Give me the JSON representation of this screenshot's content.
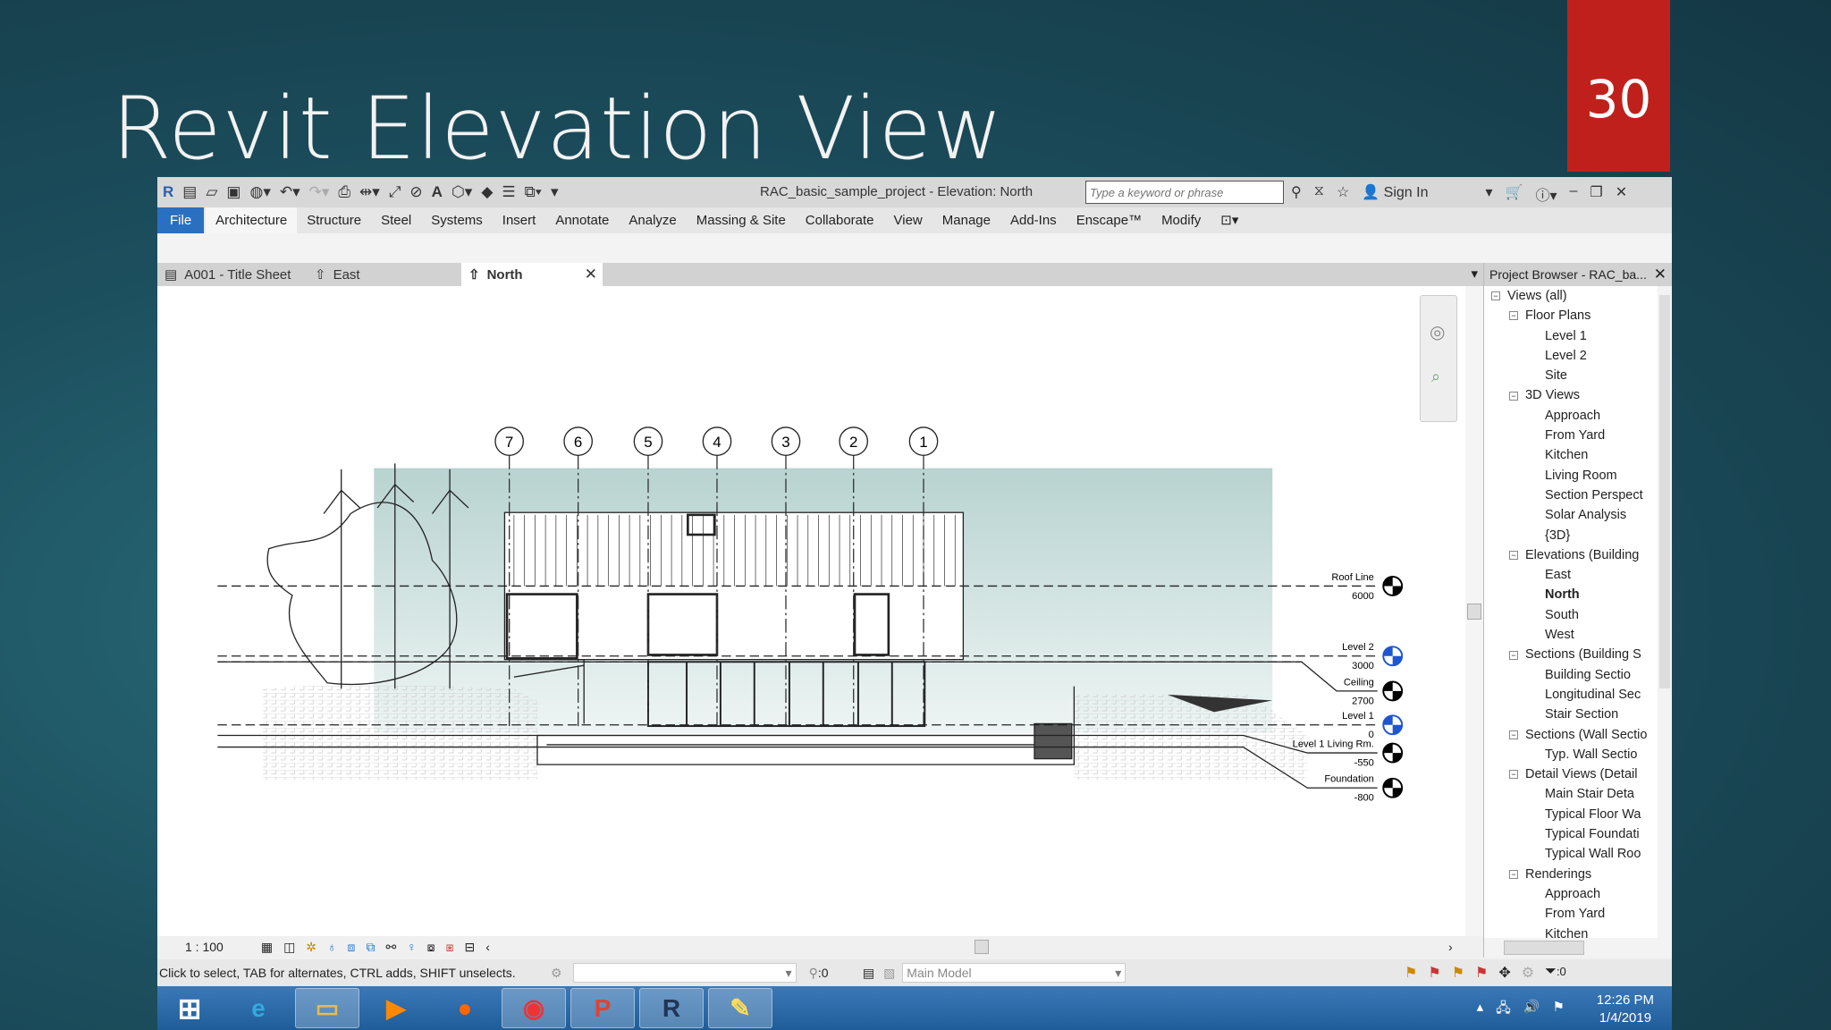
{
  "slide": {
    "title": "Revit Elevation View",
    "page_number": "30"
  },
  "app": {
    "window_title": "RAC_basic_sample_project - Elevation: North",
    "search_placeholder": "Type a keyword or phrase",
    "sign_in": "Sign In"
  },
  "ribbon_tabs": [
    "File",
    "Architecture",
    "Structure",
    "Steel",
    "Systems",
    "Insert",
    "Annotate",
    "Analyze",
    "Massing & Site",
    "Collaborate",
    "View",
    "Manage",
    "Add-Ins",
    "Enscape™",
    "Modify"
  ],
  "view_tabs": [
    {
      "label": "A001 - Title Sheet"
    },
    {
      "label": "East"
    },
    {
      "label": "North",
      "active": true
    }
  ],
  "grid_labels": [
    "7",
    "6",
    "5",
    "4",
    "3",
    "2",
    "1"
  ],
  "levels": [
    {
      "name": "Roof Line",
      "elevation": "6000",
      "color": "black"
    },
    {
      "name": "Level 2",
      "elevation": "3000",
      "color": "blue"
    },
    {
      "name": "Ceiling",
      "elevation": "2700",
      "color": "black"
    },
    {
      "name": "Level 1",
      "elevation": "0",
      "color": "blue"
    },
    {
      "name": "Level 1 Living Rm.",
      "elevation": "-550",
      "color": "black"
    },
    {
      "name": "Foundation",
      "elevation": "-800",
      "color": "black"
    }
  ],
  "view_bar": {
    "scale": "1 : 100"
  },
  "status_bar": {
    "message": "Click to select, TAB for alternates, CTRL adds, SHIFT unselects.",
    "workset_count": ":0",
    "model": "Main Model",
    "filter_count": ":0"
  },
  "project_browser": {
    "title": "Project Browser - RAC_ba...",
    "items": [
      {
        "label": "Views (all)",
        "level": 0,
        "toggle": "−"
      },
      {
        "label": "Floor Plans",
        "level": 1,
        "toggle": "−"
      },
      {
        "label": "Level 1",
        "level": 2
      },
      {
        "label": "Level 2",
        "level": 2
      },
      {
        "label": "Site",
        "level": 2
      },
      {
        "label": "3D Views",
        "level": 1,
        "toggle": "−"
      },
      {
        "label": "Approach",
        "level": 2
      },
      {
        "label": "From Yard",
        "level": 2
      },
      {
        "label": "Kitchen",
        "level": 2
      },
      {
        "label": "Living Room",
        "level": 2
      },
      {
        "label": "Section Perspect",
        "level": 2
      },
      {
        "label": "Solar Analysis",
        "level": 2
      },
      {
        "label": "{3D}",
        "level": 2
      },
      {
        "label": "Elevations (Building",
        "level": 1,
        "toggle": "−"
      },
      {
        "label": "East",
        "level": 2
      },
      {
        "label": "North",
        "level": 2,
        "selected": true
      },
      {
        "label": "South",
        "level": 2
      },
      {
        "label": "West",
        "level": 2
      },
      {
        "label": "Sections (Building S",
        "level": 1,
        "toggle": "−"
      },
      {
        "label": "Building Sectio",
        "level": 2
      },
      {
        "label": "Longitudinal Sec",
        "level": 2
      },
      {
        "label": "Stair Section",
        "level": 2
      },
      {
        "label": "Sections (Wall Sectio",
        "level": 1,
        "toggle": "−"
      },
      {
        "label": "Typ. Wall Sectio",
        "level": 2
      },
      {
        "label": "Detail Views (Detail",
        "level": 1,
        "toggle": "−"
      },
      {
        "label": "Main Stair Deta",
        "level": 2
      },
      {
        "label": "Typical Floor Wa",
        "level": 2
      },
      {
        "label": "Typical Foundati",
        "level": 2
      },
      {
        "label": "Typical Wall Roo",
        "level": 2
      },
      {
        "label": "Renderings",
        "level": 1,
        "toggle": "−"
      },
      {
        "label": "Approach",
        "level": 2
      },
      {
        "label": "From Yard",
        "level": 2
      },
      {
        "label": "Kitchen",
        "level": 2
      }
    ]
  },
  "taskbar": {
    "time": "12:26 PM",
    "date": "1/4/2019",
    "apps": [
      "start",
      "internet-explorer",
      "file-explorer",
      "media-player",
      "firefox",
      "chrome",
      "powerpoint",
      "revit",
      "paint"
    ]
  },
  "colors": {
    "file_tab": "#2a70c0",
    "slide_number_bg": "#c0201c",
    "level_blue": "#1e56d0"
  }
}
